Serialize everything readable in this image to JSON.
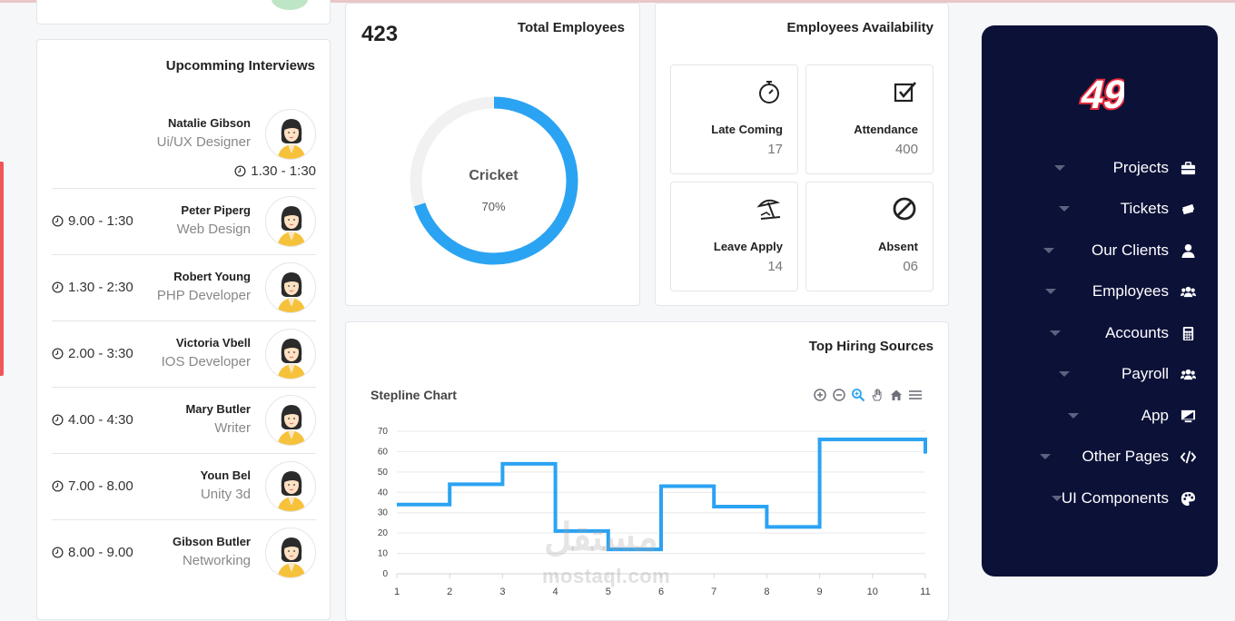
{
  "interviews": {
    "title": "Upcomming Interviews",
    "items": [
      {
        "name": "Natalie Gibson",
        "role": "Ui/UX Designer",
        "time": "1.30 - 1:30"
      },
      {
        "name": "Peter Piperg",
        "role": "Web Design",
        "time": "9.00 - 1:30"
      },
      {
        "name": "Robert Young",
        "role": "PHP Developer",
        "time": "1.30 - 2:30"
      },
      {
        "name": "Victoria Vbell",
        "role": "IOS Developer",
        "time": "2.00 - 3:30"
      },
      {
        "name": "Mary Butler",
        "role": "Writer",
        "time": "4.00 - 4:30"
      },
      {
        "name": "Youn Bel",
        "role": "Unity 3d",
        "time": "7.00 - 8.00"
      },
      {
        "name": "Gibson Butler",
        "role": "Networking",
        "time": "8.00 - 9.00"
      }
    ]
  },
  "total_employees": {
    "title": "Total Employees",
    "count": "423",
    "donut_label": "Cricket",
    "donut_percent_text": "70%",
    "donut_fraction": 0.7,
    "colors": {
      "arc": "#2ba3f3",
      "track": "#f1f1f1"
    }
  },
  "availability": {
    "title": "Employees Availability",
    "tiles": [
      {
        "label": "Late Coming",
        "value": "17",
        "icon": "stopwatch-icon"
      },
      {
        "label": "Attendance",
        "value": "400",
        "icon": "checkbox-icon"
      },
      {
        "label": "Leave Apply",
        "value": "14",
        "icon": "beach-umbrella-icon"
      },
      {
        "label": "Absent",
        "value": "06",
        "icon": "ban-icon"
      }
    ]
  },
  "hiring": {
    "title": "Top Hiring Sources",
    "chart_title": "Stepline Chart",
    "toolbar": [
      "zoom-in-icon",
      "zoom-out-icon",
      "zoom-select-icon",
      "pan-icon",
      "reset-home-icon",
      "menu-icon"
    ]
  },
  "chart_data": {
    "type": "line",
    "subtype": "stepline",
    "title": "Stepline Chart",
    "x": [
      1,
      2,
      3,
      4,
      5,
      6,
      7,
      8,
      9,
      10,
      11
    ],
    "series": [
      {
        "values": [
          34,
          44,
          54,
          21,
          12,
          43,
          33,
          23,
          66,
          66,
          59
        ]
      }
    ],
    "xticks": [
      1,
      2,
      3,
      4,
      5,
      6,
      7,
      8,
      9,
      10,
      11
    ],
    "yticks": [
      0,
      10,
      20,
      30,
      40,
      50,
      60,
      70
    ],
    "ylim": [
      0,
      70
    ],
    "grid": "horizontal",
    "color": "#2ba3f3"
  },
  "sidebar": {
    "items": [
      {
        "label": "Projects",
        "icon": "briefcase-icon"
      },
      {
        "label": "Tickets",
        "icon": "ticket-icon"
      },
      {
        "label": "Our Clients",
        "icon": "user-icon"
      },
      {
        "label": "Employees",
        "icon": "users-icon"
      },
      {
        "label": "Accounts",
        "icon": "calculator-icon"
      },
      {
        "label": "Payroll",
        "icon": "users-icon"
      },
      {
        "label": "App",
        "icon": "monitor-icon"
      },
      {
        "label": "Other Pages",
        "icon": "code-icon"
      },
      {
        "label": "UI Components",
        "icon": "palette-icon"
      }
    ],
    "logo_text": "49",
    "colors": {
      "bg": "#0c1138",
      "logo_red": "#e8293b"
    }
  },
  "watermark": {
    "arabic": "مستقل",
    "latin": "mostaql.com"
  }
}
